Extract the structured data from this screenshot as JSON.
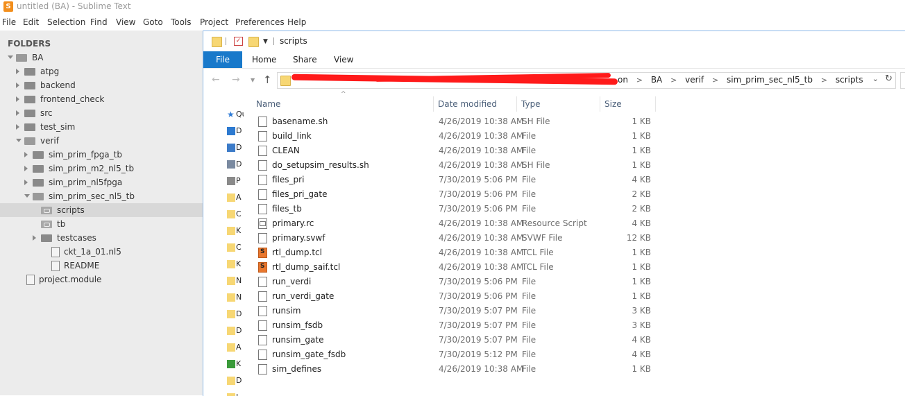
{
  "window": {
    "title": "untitled (BA) - Sublime Text",
    "menu": [
      "File",
      "Edit",
      "Selection",
      "Find",
      "View",
      "Goto",
      "Tools",
      "Project",
      "Preferences",
      "Help"
    ]
  },
  "sidebar": {
    "header": "FOLDERS",
    "items": [
      {
        "label": "BA",
        "depth": 0,
        "kind": "folder",
        "expanded": true
      },
      {
        "label": "atpg",
        "depth": 1,
        "kind": "folder",
        "expanded": false
      },
      {
        "label": "backend",
        "depth": 1,
        "kind": "folder",
        "expanded": false
      },
      {
        "label": "frontend_check",
        "depth": 1,
        "kind": "folder",
        "expanded": false
      },
      {
        "label": "src",
        "depth": 1,
        "kind": "folder",
        "expanded": false
      },
      {
        "label": "test_sim",
        "depth": 1,
        "kind": "folder",
        "expanded": false
      },
      {
        "label": "verif",
        "depth": 1,
        "kind": "folder",
        "expanded": true
      },
      {
        "label": "sim_prim_fpga_tb",
        "depth": 2,
        "kind": "folder",
        "expanded": false
      },
      {
        "label": "sim_prim_m2_nl5_tb",
        "depth": 2,
        "kind": "folder",
        "expanded": false
      },
      {
        "label": "sim_prim_nl5fpga",
        "depth": 2,
        "kind": "folder",
        "expanded": false
      },
      {
        "label": "sim_prim_sec_nl5_tb",
        "depth": 2,
        "kind": "folder",
        "expanded": true
      },
      {
        "label": "scripts",
        "depth": 3,
        "kind": "link",
        "selected": true
      },
      {
        "label": "tb",
        "depth": 3,
        "kind": "link"
      },
      {
        "label": "testcases",
        "depth": 3,
        "kind": "folder",
        "expanded": false
      },
      {
        "label": "ckt_1a_01.nl5",
        "depth": 3,
        "kind": "file"
      },
      {
        "label": "README",
        "depth": 3,
        "kind": "file"
      },
      {
        "label": "project.module",
        "depth": 0,
        "kind": "file"
      }
    ]
  },
  "explorer": {
    "title": "scripts",
    "ribbon_tabs": [
      "File",
      "Home",
      "Share",
      "View"
    ],
    "breadcrumb": [
      "BA",
      "verif",
      "sim_prim_sec_nl5_tb",
      "scripts"
    ],
    "breadcrumb_partial": "on",
    "nav_pane_labels": [
      "Qu",
      "D",
      "D",
      "D",
      "P",
      "A",
      "C",
      "K",
      "C",
      "K",
      "N",
      "N",
      "D",
      "D",
      "A",
      "K",
      "D",
      "I"
    ],
    "columns": [
      "Name",
      "Date modified",
      "Type",
      "Size"
    ],
    "files": [
      {
        "name": "basename.sh",
        "date": "4/26/2019 10:38 AM",
        "type": "SH File",
        "size": "1 KB",
        "icon": "file"
      },
      {
        "name": "build_link",
        "date": "4/26/2019 10:38 AM",
        "type": "File",
        "size": "1 KB",
        "icon": "file"
      },
      {
        "name": "CLEAN",
        "date": "4/26/2019 10:38 AM",
        "type": "File",
        "size": "1 KB",
        "icon": "file"
      },
      {
        "name": "do_setupsim_results.sh",
        "date": "4/26/2019 10:38 AM",
        "type": "SH File",
        "size": "1 KB",
        "icon": "file"
      },
      {
        "name": "files_pri",
        "date": "7/30/2019 5:06 PM",
        "type": "File",
        "size": "4 KB",
        "icon": "file"
      },
      {
        "name": "files_pri_gate",
        "date": "7/30/2019 5:06 PM",
        "type": "File",
        "size": "2 KB",
        "icon": "file"
      },
      {
        "name": "files_tb",
        "date": "7/30/2019 5:06 PM",
        "type": "File",
        "size": "2 KB",
        "icon": "file"
      },
      {
        "name": "primary.rc",
        "date": "4/26/2019 10:38 AM",
        "type": "Resource Script",
        "size": "4 KB",
        "icon": "image"
      },
      {
        "name": "primary.svwf",
        "date": "4/26/2019 10:38 AM",
        "type": "SVWF File",
        "size": "12 KB",
        "icon": "file"
      },
      {
        "name": "rtl_dump.tcl",
        "date": "4/26/2019 10:38 AM",
        "type": "TCL File",
        "size": "1 KB",
        "icon": "sublime"
      },
      {
        "name": "rtl_dump_saif.tcl",
        "date": "4/26/2019 10:38 AM",
        "type": "TCL File",
        "size": "1 KB",
        "icon": "sublime"
      },
      {
        "name": "run_verdi",
        "date": "7/30/2019 5:06 PM",
        "type": "File",
        "size": "1 KB",
        "icon": "file"
      },
      {
        "name": "run_verdi_gate",
        "date": "7/30/2019 5:06 PM",
        "type": "File",
        "size": "1 KB",
        "icon": "file"
      },
      {
        "name": "runsim",
        "date": "7/30/2019 5:07 PM",
        "type": "File",
        "size": "3 KB",
        "icon": "file"
      },
      {
        "name": "runsim_fsdb",
        "date": "7/30/2019 5:07 PM",
        "type": "File",
        "size": "3 KB",
        "icon": "file"
      },
      {
        "name": "runsim_gate",
        "date": "7/30/2019 5:07 PM",
        "type": "File",
        "size": "4 KB",
        "icon": "file"
      },
      {
        "name": "runsim_gate_fsdb",
        "date": "7/30/2019 5:12 PM",
        "type": "File",
        "size": "4 KB",
        "icon": "file"
      },
      {
        "name": "sim_defines",
        "date": "4/26/2019 10:38 AM",
        "type": "File",
        "size": "1 KB",
        "icon": "file"
      }
    ]
  },
  "colors": {
    "accent": "#1979ca",
    "redaction": "#ff1a1a",
    "sidebar_bg": "#ececec",
    "selected_row": "#d8d8d8"
  }
}
